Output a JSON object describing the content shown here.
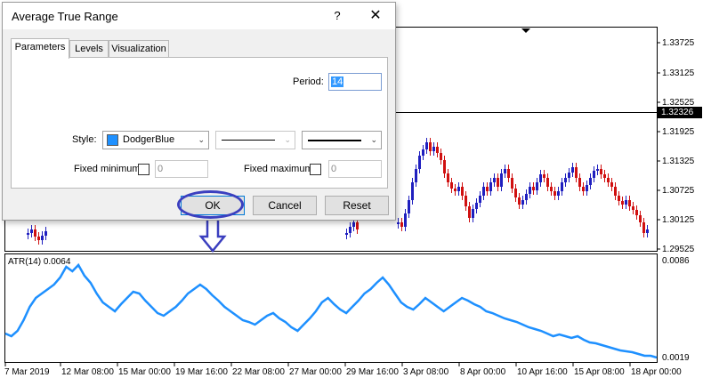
{
  "dialog": {
    "title": "Average True Range",
    "help_label": "?",
    "close_label": "✕",
    "tabs": [
      {
        "label": "Parameters",
        "active": true
      },
      {
        "label": "Levels",
        "active": false
      },
      {
        "label": "Visualization",
        "active": false
      }
    ],
    "period": {
      "label": "Period:",
      "value": "14"
    },
    "style": {
      "label": "Style:",
      "color_name": "DodgerBlue",
      "color": "#1e90ff"
    },
    "fixed_minimum": {
      "label": "Fixed minimum",
      "checked": false,
      "value": "0"
    },
    "fixed_maximum": {
      "label": "Fixed maximum",
      "checked": false,
      "value": "0"
    },
    "buttons": {
      "ok": "OK",
      "cancel": "Cancel",
      "reset": "Reset"
    }
  },
  "chart": {
    "price_axis": [
      "1.33725",
      "1.33125",
      "1.32525",
      "1.31925",
      "1.31325",
      "1.30725",
      "1.30125",
      "1.29525"
    ],
    "current_price": "1.32326",
    "atr_title": "ATR(14) 0.0064",
    "atr_axis": [
      "0.0086",
      "0.0019"
    ],
    "time_axis": [
      "7 Mar 2019",
      "12 Mar 08:00",
      "15 Mar 00:00",
      "19 Mar 16:00",
      "22 Mar 08:00",
      "27 Mar 00:00",
      "29 Mar 16:00",
      "3 Apr 08:00",
      "8 Apr 00:00",
      "10 Apr 16:00",
      "15 Apr 08:00",
      "18 Apr 00:00"
    ],
    "colors": {
      "bull": "#1f1fbf",
      "bear": "#d01010",
      "atr_line": "#1e90ff"
    }
  }
}
